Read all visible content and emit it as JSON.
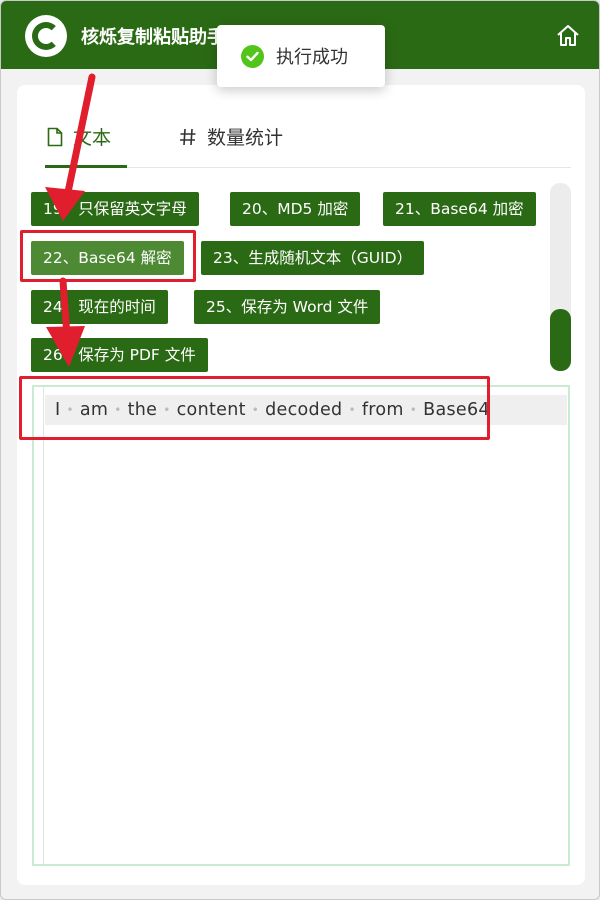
{
  "app": {
    "title": "核烁复制粘贴助手",
    "theme_color": "#2b6a14",
    "logo_icon": "c-logo-icon",
    "home_icon": "home-icon"
  },
  "toast": {
    "message": "执行成功",
    "icon": "check-circle-icon",
    "icon_color": "#52c41a"
  },
  "tabs": [
    {
      "label": "文本",
      "icon": "file-icon",
      "active": true
    },
    {
      "label": "数量统计",
      "icon": "hash-icon",
      "active": false
    }
  ],
  "actions": [
    {
      "label": "19、只保留英文字母"
    },
    {
      "label": "20、MD5 加密"
    },
    {
      "label": "21、Base64 加密"
    },
    {
      "label": "22、Base64 解密",
      "selected": true
    },
    {
      "label": "23、生成随机文本（GUID）"
    },
    {
      "label": "24、现在的时间"
    },
    {
      "label": "25、保存为 Word 文件"
    },
    {
      "label": "26、保存为 PDF 文件"
    }
  ],
  "editor": {
    "words": [
      "I",
      "am",
      "the",
      "content",
      "decoded",
      "from",
      "Base64"
    ]
  },
  "annotations": {
    "color": "#e01e2e"
  }
}
